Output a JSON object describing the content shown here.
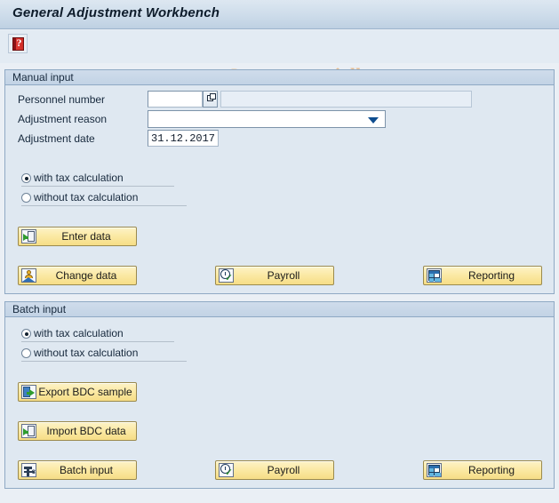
{
  "window": {
    "title": "General Adjustment Workbench"
  },
  "toolbar": {
    "help_icon": "help-book-icon",
    "watermark": "www.tutorialkart.com",
    "watermark_copyright": "©"
  },
  "manual_input": {
    "group_title": "Manual input",
    "fields": [
      {
        "label": "Personnel number",
        "value": "",
        "placeholder": ""
      },
      {
        "label": "Adjustment reason",
        "value": "",
        "placeholder": ""
      },
      {
        "label": "Adjustment date",
        "value": "31.12.2017",
        "placeholder": ""
      }
    ],
    "radios": [
      {
        "label": "with tax calculation",
        "selected": true
      },
      {
        "label": "without tax calculation",
        "selected": false
      }
    ],
    "buttons": [
      {
        "label": "Enter data",
        "icon": "import-document-icon"
      },
      {
        "label": "Change data",
        "icon": "person-mountain-icon"
      },
      {
        "label": "Payroll",
        "icon": "clock-check-icon"
      },
      {
        "label": "Reporting",
        "icon": "table-grid-icon"
      }
    ]
  },
  "batch_input": {
    "group_title": "Batch input",
    "radios": [
      {
        "label": "with tax calculation",
        "selected": true
      },
      {
        "label": "without tax calculation",
        "selected": false
      }
    ],
    "buttons": [
      {
        "label": "Export BDC sample",
        "icon": "export-document-icon"
      },
      {
        "label": "Import BDC data",
        "icon": "import-document-icon"
      },
      {
        "label": "Batch input",
        "icon": "batch-pipe-icon"
      },
      {
        "label": "Payroll",
        "icon": "clock-check-icon"
      },
      {
        "label": "Reporting",
        "icon": "table-grid-icon"
      }
    ]
  },
  "colors": {
    "titlebar": "#cddcea",
    "panel_bg": "#dfe8f1",
    "panel_border": "#8fa9c4",
    "button_face": "#fbeaa6",
    "button_border": "#9a8a4e",
    "page_bg": "#eaeff5",
    "watermark": "#e7bb8c"
  }
}
